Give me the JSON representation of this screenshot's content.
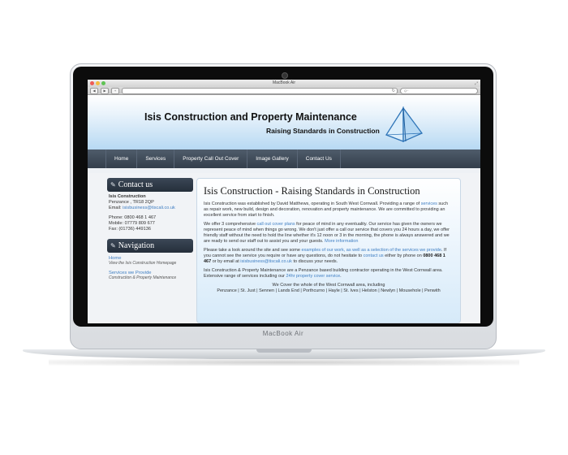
{
  "device": {
    "brand_label": "MacBook Air"
  },
  "browser": {
    "window_title": "MacBook Air",
    "url": "",
    "search_placeholder": "Q~",
    "back_label": "◀",
    "forward_label": "▶",
    "plus_label": "+"
  },
  "site": {
    "title": "Isis Construction and Property Maintenance",
    "slogan": "Raising Standards in Construction",
    "nav": [
      "Home",
      "Services",
      "Property Call Out Cover",
      "Image Gallery",
      "Contact Us"
    ],
    "contact": {
      "heading": "Contact us",
      "company": "Isis Construction",
      "address": "Penzance , TR18 2QP",
      "email_label": "Email:",
      "email": "isisbusiness@tiscali.co.uk",
      "phone": "Phone: 0800 468 1 467",
      "mobile": "Mobile: 07779 809 677",
      "fax": "Fax: (01736) 449136"
    },
    "navigation": {
      "heading": "Navigation",
      "items": [
        {
          "label": "Home",
          "sub": "View the Isis Construction Homepage"
        },
        {
          "label": "Services we Provide",
          "sub": "Construction & Property Maintenance"
        }
      ]
    },
    "main": {
      "heading": "Isis Construction - Raising Standards in Construction",
      "p1_a": "Isis Construction was established by David Matthews, operating in  South West Cornwall. Providing a range of ",
      "p1_link": "services",
      "p1_b": " such as repair work, new build, design and decoration, renovation and property maintenance. We are committed to providing an excellent service from start to finish.",
      "p2_a": "We offer 3 comprehensive ",
      "p2_link": "call out cover plans",
      "p2_b": " for peace of mind in any eventuality. Our service has given the owners we represent peace of mind when things go wrong.  We don't just offer a call our service that covers you 24 hours a day, we offer friendly staff without the need to hold the line whether it's 12 noon or 3 in the morning, the phone is always answered and we are ready to send our staff out to assist you and your guests. ",
      "p2_more": "More information",
      "p3_a": "Please take a look around the site and see some ",
      "p3_link": "examples of our work, as well as a selection of the services we provide",
      "p3_b": ". If you cannot see the service you require or have any questions, do not hesitate to ",
      "p3_contact": "contact us",
      "p3_c": " either by phone on ",
      "p3_phone": "0800 468 1 467",
      "p3_d": " or by email at ",
      "p3_email": "isisbusiness@tiscali.co.uk",
      "p3_e": " to discuss your needs.",
      "p4_a": "Isis Construction & Property Maintenance are a Penzance based building contractor operating in the West Cornwall area. Extensive range of services including our ",
      "p4_link": "24hr property cover service",
      "p4_b": ".",
      "areas_intro": "We Cover the whole of the West Cornwall area, including",
      "areas": "Penzance | St. Just | Sennen | Lands End | Porthcurno | Hayle | St. Ives | Helston | Newlyn | Mousehole | Penwith"
    }
  }
}
